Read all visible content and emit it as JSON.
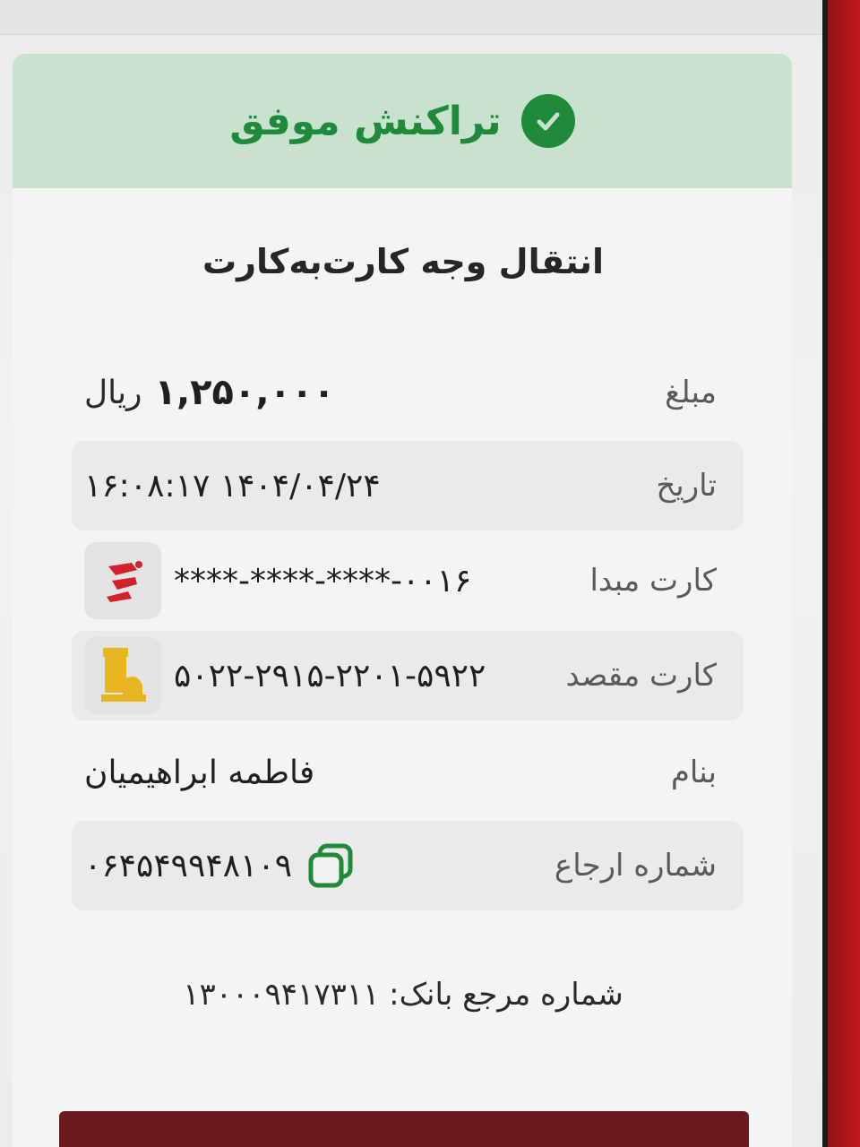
{
  "banner": {
    "text": "تراکنش موفق",
    "color": "#1e8a3a",
    "background": "#c9e2cf"
  },
  "receipt": {
    "title": "انتقال وجه کارت‌به‌کارت",
    "amount": {
      "label": "مبلغ",
      "value": "۱,۲۵۰,۰۰۰",
      "unit": "ریال"
    },
    "date": {
      "label": "تاریخ",
      "value": "۱۴۰۴/۰۴/۲۴ ۱۶:۰۸:۱۷"
    },
    "source_card": {
      "label": "کارت مبدا",
      "value": "****-****-****-۰۰۱۶",
      "bank_icon": "saderat-bank-logo",
      "bank_color": "#d4202a"
    },
    "dest_card": {
      "label": "کارت مقصد",
      "value": "۵۰۲۲-۲۹۱۵-۲۲۰۱-۵۹۲۲",
      "bank_icon": "pasargad-bank-logo",
      "bank_color": "#e7b51f"
    },
    "recipient": {
      "label": "بنام",
      "value": "فاطمه ابراهیمیان"
    },
    "tracking": {
      "label": "شماره ارجاع",
      "value": "۰۶۴۵۴۹۹۴۸۱۰۹",
      "icon": "copy-icon"
    },
    "bank_reference": "شماره مرجع بانک: ۱۳۰۰۰۹۴۱۷۳۱۱"
  }
}
